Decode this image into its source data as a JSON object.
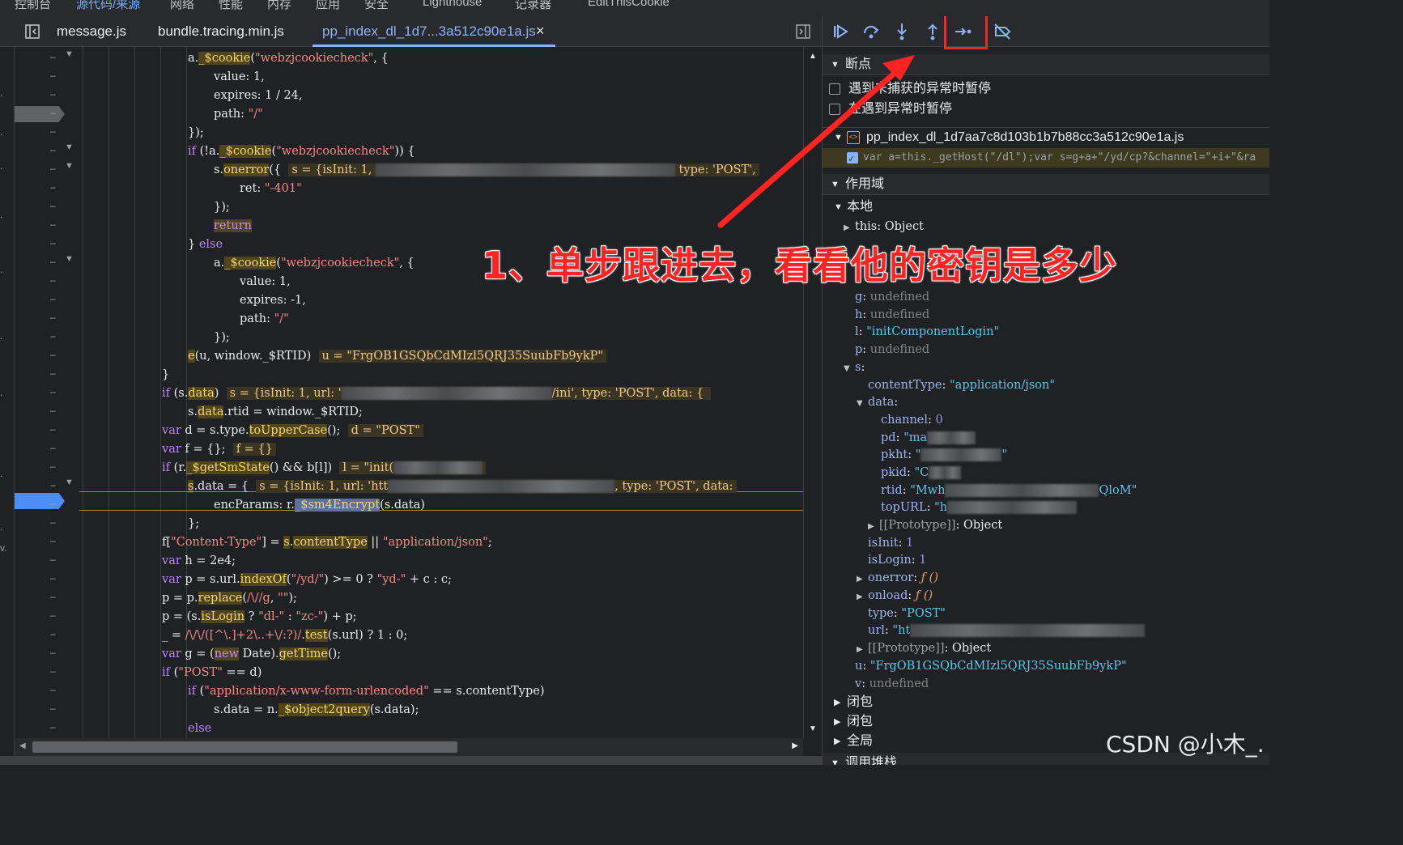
{
  "top_tabs": [
    "控制台",
    "源代码/来源",
    "网络",
    "性能",
    "内存",
    "应用",
    "安全",
    "Lighthouse",
    "记录器",
    "EditThisCookie"
  ],
  "file_tabs": [
    "message.js",
    "bundle.tracing.min.js",
    "pp_index_dl_1d7...3a512c90e1a.js"
  ],
  "code": {
    "l1": "a._$cookie(\"webzjcookiecheck\", {",
    "inline_u": "u = \"FrgOB1GSQbCdMIzl5QRJ35SuubFb9ykP\"",
    "inline_d": "d = \"POST\"",
    "inline_f": "f = {}",
    "inline_l": "l = \"init(",
    "inline_s1": "s = {isInit: 1,",
    "inline_s2": "s = {isInit: 1, url: '",
    "inline_s3": "s = {isInit: 1, url: 'htt",
    "regex_line": "_ = /\\/\\/([^\\.]+2\\..+\\/:?)/.test(s.url) ? 1 : 0;"
  },
  "debugger": {
    "breakpoints_title": "断点",
    "pause_uncaught": "遇到未捕获的异常时暂停",
    "pause_caught": "在遇到异常时暂停",
    "bp_file": "pp_index_dl_1d7aa7c8d103b1b7b88cc3a512c90e1a.js",
    "bp_code": "var a=this._getHost(\"/dl\");var s=g+a+\"/yd/cp?&channel=\"+i+\"&ra",
    "scope_title": "作用域",
    "local_title": "本地",
    "this_val": "Object",
    "g_val": "undefined",
    "h_val": "undefined",
    "l_val": "\"initComponentLogin\"",
    "p_val": "undefined",
    "contentType_val": "\"application/json\"",
    "channel_val": "0",
    "pd_val": "\"ma",
    "pkht_val": "\"",
    "pkid_val": "\"C",
    "rtid_val": "\"Mwh",
    "rtid_tail": "QloM\"",
    "topURL_val": "\"h",
    "proto_val": "Object",
    "isInit_val": "1",
    "isLogin_val": "1",
    "onerror_val": "ƒ ()",
    "onload_val": "ƒ ()",
    "type_val": "\"POST\"",
    "url_val": "\"ht",
    "u_val": "\"FrgOB1GSQbCdMIzl5QRJ35SuubFb9ykP\"",
    "v_val": "undefined",
    "closure1": "闭包",
    "closure2": "闭包",
    "global": "全局",
    "callstack": "调用堆栈"
  },
  "annotation": "1、单步跟进去，看看他的密钥是多少",
  "watermark": "CSDN @小木_.",
  "colors": {
    "accent": "#8ab4f8",
    "annotation_red": "#ff2424",
    "breakpoint_blue": "#4c8df6"
  }
}
